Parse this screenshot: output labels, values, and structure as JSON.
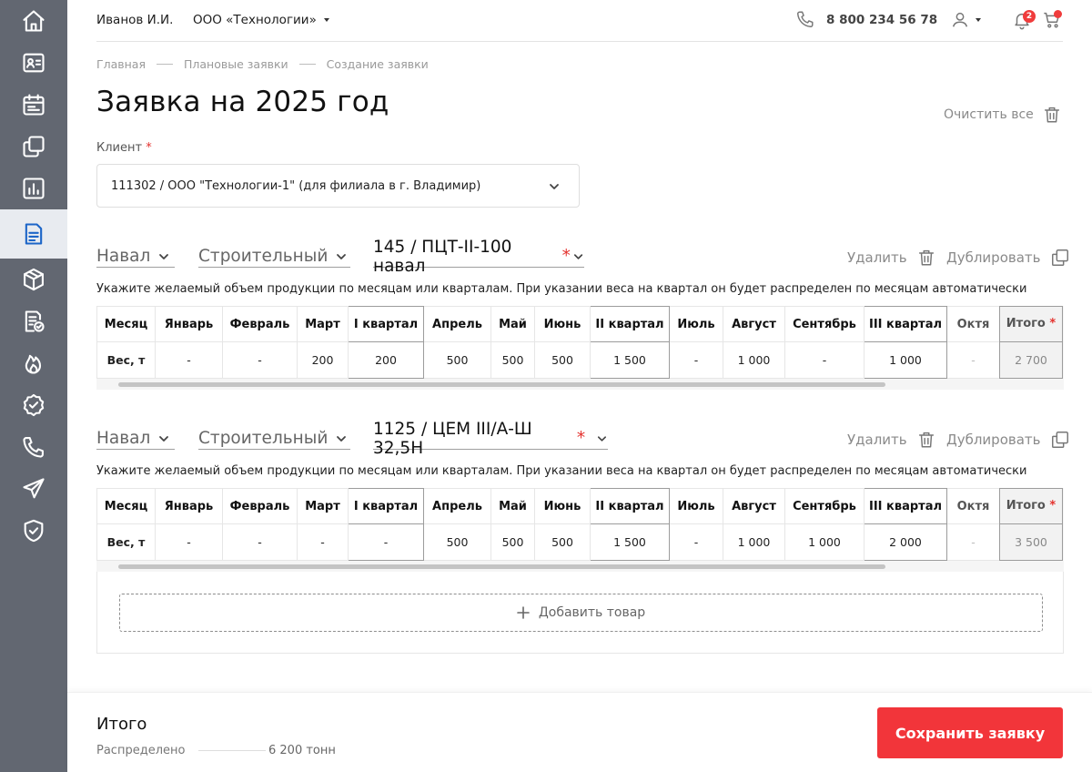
{
  "sidebar": {
    "items": [
      {
        "icon": "home-icon"
      },
      {
        "icon": "contact-card-icon"
      },
      {
        "icon": "calendar-icon"
      },
      {
        "icon": "copy-icon"
      },
      {
        "icon": "chart-icon"
      },
      {
        "icon": "document-list-icon",
        "active": true
      },
      {
        "icon": "box-icon"
      },
      {
        "icon": "document-check-icon"
      },
      {
        "icon": "flame-icon"
      },
      {
        "icon": "badge-check-icon"
      },
      {
        "icon": "phone-icon"
      },
      {
        "icon": "send-icon"
      },
      {
        "icon": "shield-check-icon"
      }
    ]
  },
  "header": {
    "user_name": "Иванов И.И.",
    "company": "ООО «Технологии»",
    "phone": "8 800 234 56 78",
    "notifications_count": "2"
  },
  "breadcrumb": [
    "Главная",
    "Плановые заявки",
    "Создание заявки"
  ],
  "page": {
    "title": "Заявка на 2025 год",
    "clear_all": "Очистить все",
    "client_label": "Клиент",
    "required_mark": "*",
    "client_value": "111302 / ООО \"Технологии-1\" (для филиала в г. Владимир)"
  },
  "product_common": {
    "delete_label": "Удалить",
    "duplicate_label": "Дублировать",
    "hint": "Укажите желаемый объем продукции по месяцам или кварталам. При указании веса на квартал он будет распределен по месяцам автоматически",
    "columns": [
      "Месяц",
      "Январь",
      "Февраль",
      "Март",
      "I квартал",
      "Апрель",
      "Май",
      "Июнь",
      "II квартал",
      "Июль",
      "Август",
      "Сентябрь",
      "III квартал",
      "Октя"
    ],
    "row_label": "Вес, т",
    "total_label": "Итого"
  },
  "products": [
    {
      "type": "Навал",
      "category": "Строительный",
      "product": "145 / ПЦТ-II-100 навал",
      "values": [
        "-",
        "-",
        "200",
        "200",
        "500",
        "500",
        "500",
        "1 500",
        "-",
        "1 000",
        "-",
        "1 000",
        "-"
      ],
      "total": "2 700"
    },
    {
      "type": "Навал",
      "category": "Строительный",
      "product": "1125 / ЦЕМ III/А-Ш 32,5Н",
      "values": [
        "-",
        "-",
        "-",
        "-",
        "500",
        "500",
        "500",
        "1 500",
        "-",
        "1 000",
        "1 000",
        "2 000",
        "-"
      ],
      "total": "3 500"
    }
  ],
  "add_product_label": "Добавить товар",
  "footer": {
    "title": "Итого",
    "distributed_label": "Распределено",
    "distributed_value": "6 200 тонн",
    "save_label": "Сохранить заявку"
  },
  "colors": {
    "sidebar_bg": "#626771",
    "accent_red": "#f2353a",
    "active_icon": "#1c65c8"
  }
}
